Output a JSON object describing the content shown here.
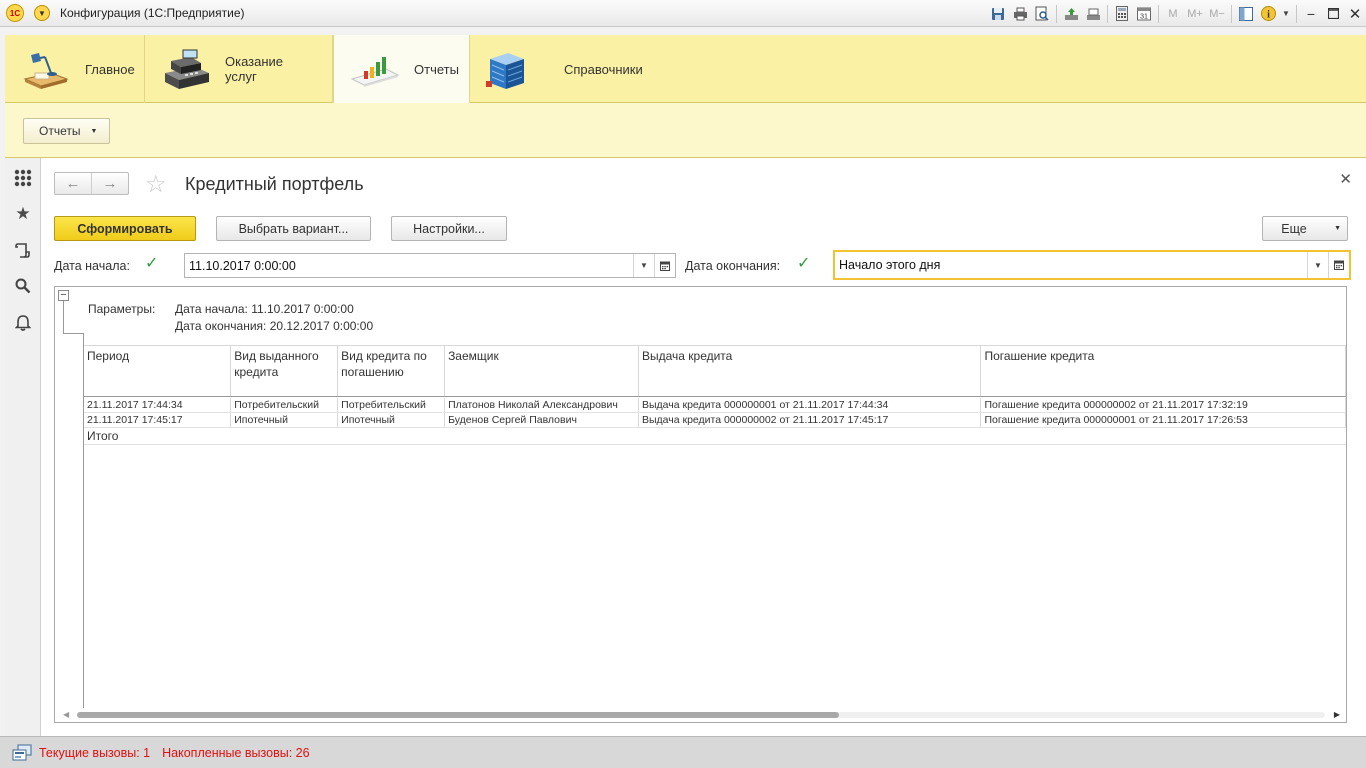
{
  "window": {
    "title": "Конфигурация  (1С:Предприятие)",
    "logo": "1С"
  },
  "sections": [
    {
      "label": "Главное",
      "icon": "desk-lamp-icon"
    },
    {
      "label": "Оказание услуг",
      "icon": "cash-register-icon"
    },
    {
      "label": "Отчеты",
      "icon": "report-chart-icon",
      "active": true
    },
    {
      "label": "Справочники",
      "icon": "building-icon"
    }
  ],
  "commands": {
    "reports_menu_label": "Отчеты"
  },
  "form": {
    "title": "Кредитный портфель",
    "generate_label": "Сформировать",
    "choose_variant_label": "Выбрать вариант...",
    "settings_label": "Настройки...",
    "more_label": "Еще",
    "start_date_label": "Дата начала:",
    "start_date_value": "11.10.2017  0:00:00",
    "end_date_label": "Дата окончания:",
    "end_date_value": "Начало этого дня"
  },
  "report": {
    "params_label": "Параметры:",
    "params_start": "Дата начала: 11.10.2017 0:00:00",
    "params_end": "Дата окончания: 20.12.2017 0:00:00",
    "columns": [
      "Период",
      "Вид выданного кредита",
      "Вид кредита по погашению",
      "Заемщик",
      "Выдача кредита",
      "Погашение кредита"
    ],
    "rows": [
      [
        "21.11.2017 17:44:34",
        "Потребительский",
        "Потребительский",
        "Платонов Николай Александрович",
        "Выдача кредита 000000001 от 21.11.2017 17:44:34",
        "Погашение кредита 000000002 от 21.11.2017 17:32:19"
      ],
      [
        "21.11.2017 17:45:17",
        "Ипотечный",
        "Ипотечный",
        "Буденов Сергей Павлович",
        "Выдача кредита 000000002 от 21.11.2017 17:45:17",
        "Погашение кредита 000000001 от 21.11.2017 17:26:53"
      ]
    ],
    "total_label": "Итого"
  },
  "status": {
    "current_calls": "Текущие вызовы: 1",
    "accumulated_calls": "Накопленные вызовы: 26"
  },
  "colors": {
    "section_bg": "#fbf1a5",
    "commands_bg": "#fdf8cc",
    "primary_button": "#f5d530",
    "focus_border": "#f2c233",
    "status_text": "#e01010"
  }
}
